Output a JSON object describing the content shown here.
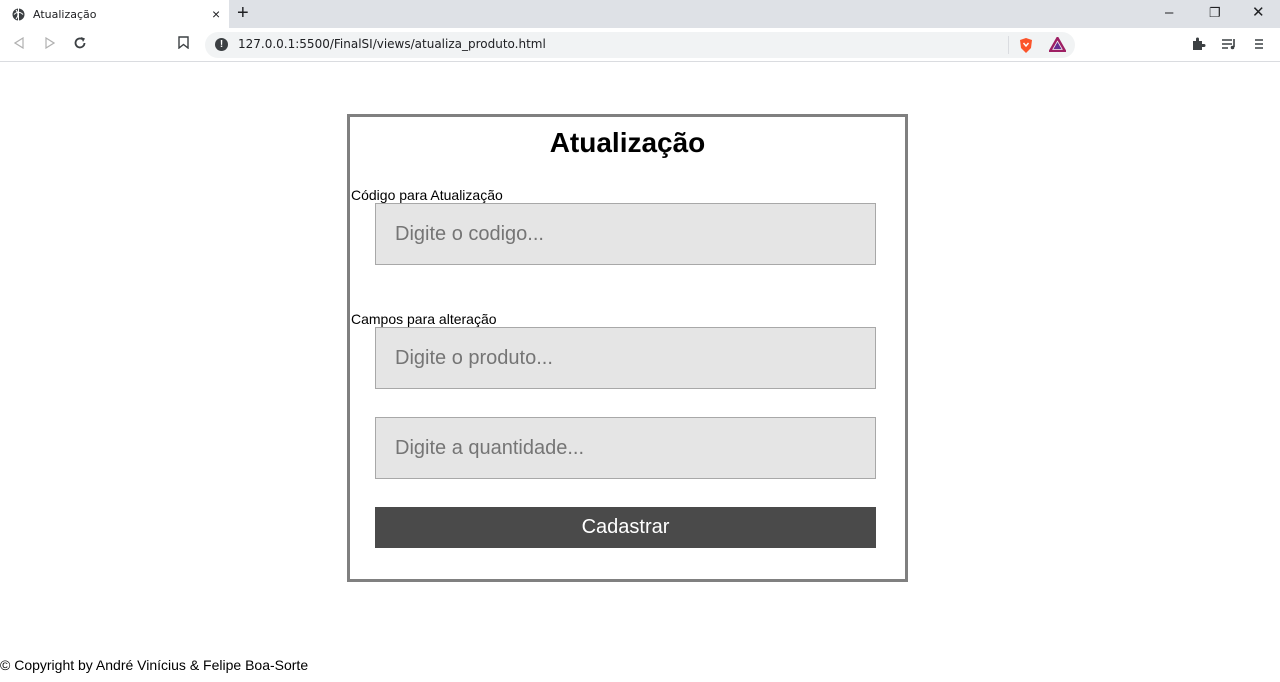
{
  "browser": {
    "tab_title": "Atualização",
    "tab_close": "×",
    "new_tab": "+",
    "url": "127.0.0.1:5500/FinalSI/views/atualiza_produto.html",
    "window_controls": {
      "minimize": "–",
      "restore": "❐",
      "close": "✕"
    },
    "icons": [
      "globe-icon",
      "back-icon",
      "forward-icon",
      "reload-icon",
      "bookmark-icon",
      "info-icon",
      "brave-shields-icon",
      "brave-rewards-icon",
      "extensions-icon",
      "media-queue-icon",
      "menu-icon"
    ]
  },
  "form": {
    "title": "Atualização",
    "code_label": "Código para Atualização",
    "code_placeholder": "Digite o codigo...",
    "fields_label": "Campos para alteração",
    "product_placeholder": "Digite o produto...",
    "quantity_placeholder": "Digite a quantidade...",
    "submit_label": "Cadastrar"
  },
  "footer": {
    "text": "© Copyright by André Vinícius & Felipe Boa-Sorte"
  },
  "colors": {
    "button_bg": "#4a4a4a",
    "input_bg": "#e5e5e5",
    "form_border": "#808080",
    "brave_orange": "#fb542b"
  }
}
